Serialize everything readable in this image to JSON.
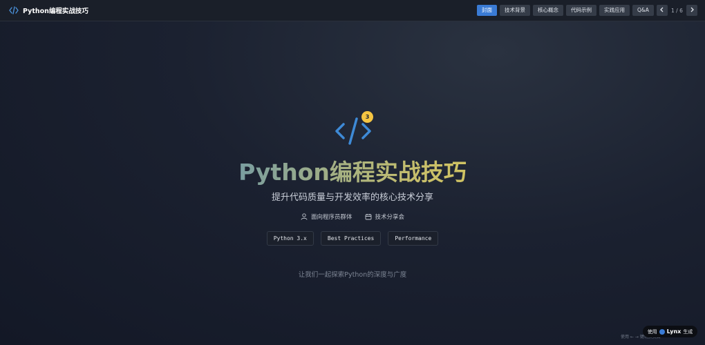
{
  "header": {
    "brand_icon": "code-icon",
    "title": "Python编程实战技巧",
    "nav": [
      {
        "label": "封面",
        "active": true
      },
      {
        "label": "技术背景",
        "active": false
      },
      {
        "label": "核心概念",
        "active": false
      },
      {
        "label": "代码示例",
        "active": false
      },
      {
        "label": "实践应用",
        "active": false
      },
      {
        "label": "Q&A",
        "active": false
      }
    ],
    "pager": {
      "text": "1 / 6",
      "prev_icon": "chevron-left-icon",
      "next_icon": "chevron-right-icon"
    }
  },
  "hero": {
    "icon": "code-icon",
    "badge": "3",
    "title": "Python编程实战技巧",
    "subtitle": "提升代码质量与开发效率的核心技术分享",
    "meta": [
      {
        "icon": "user-icon",
        "text": "面向程序员群体"
      },
      {
        "icon": "calendar-icon",
        "text": "技术分享会"
      }
    ],
    "tags": [
      "Python 3.x",
      "Best Practices",
      "Performance"
    ],
    "tagline": "让我们一起探索Python的深度与广度"
  },
  "footer": {
    "hint": "使用 ← → 键切换页面",
    "badge_prefix": "使用",
    "badge_brand": "Lynx",
    "badge_suffix": "生成"
  },
  "colors": {
    "accent": "#3a7bd5",
    "badge": "#f5c542",
    "title_start": "#3e7fc7",
    "title_end": "#f5d43a"
  }
}
